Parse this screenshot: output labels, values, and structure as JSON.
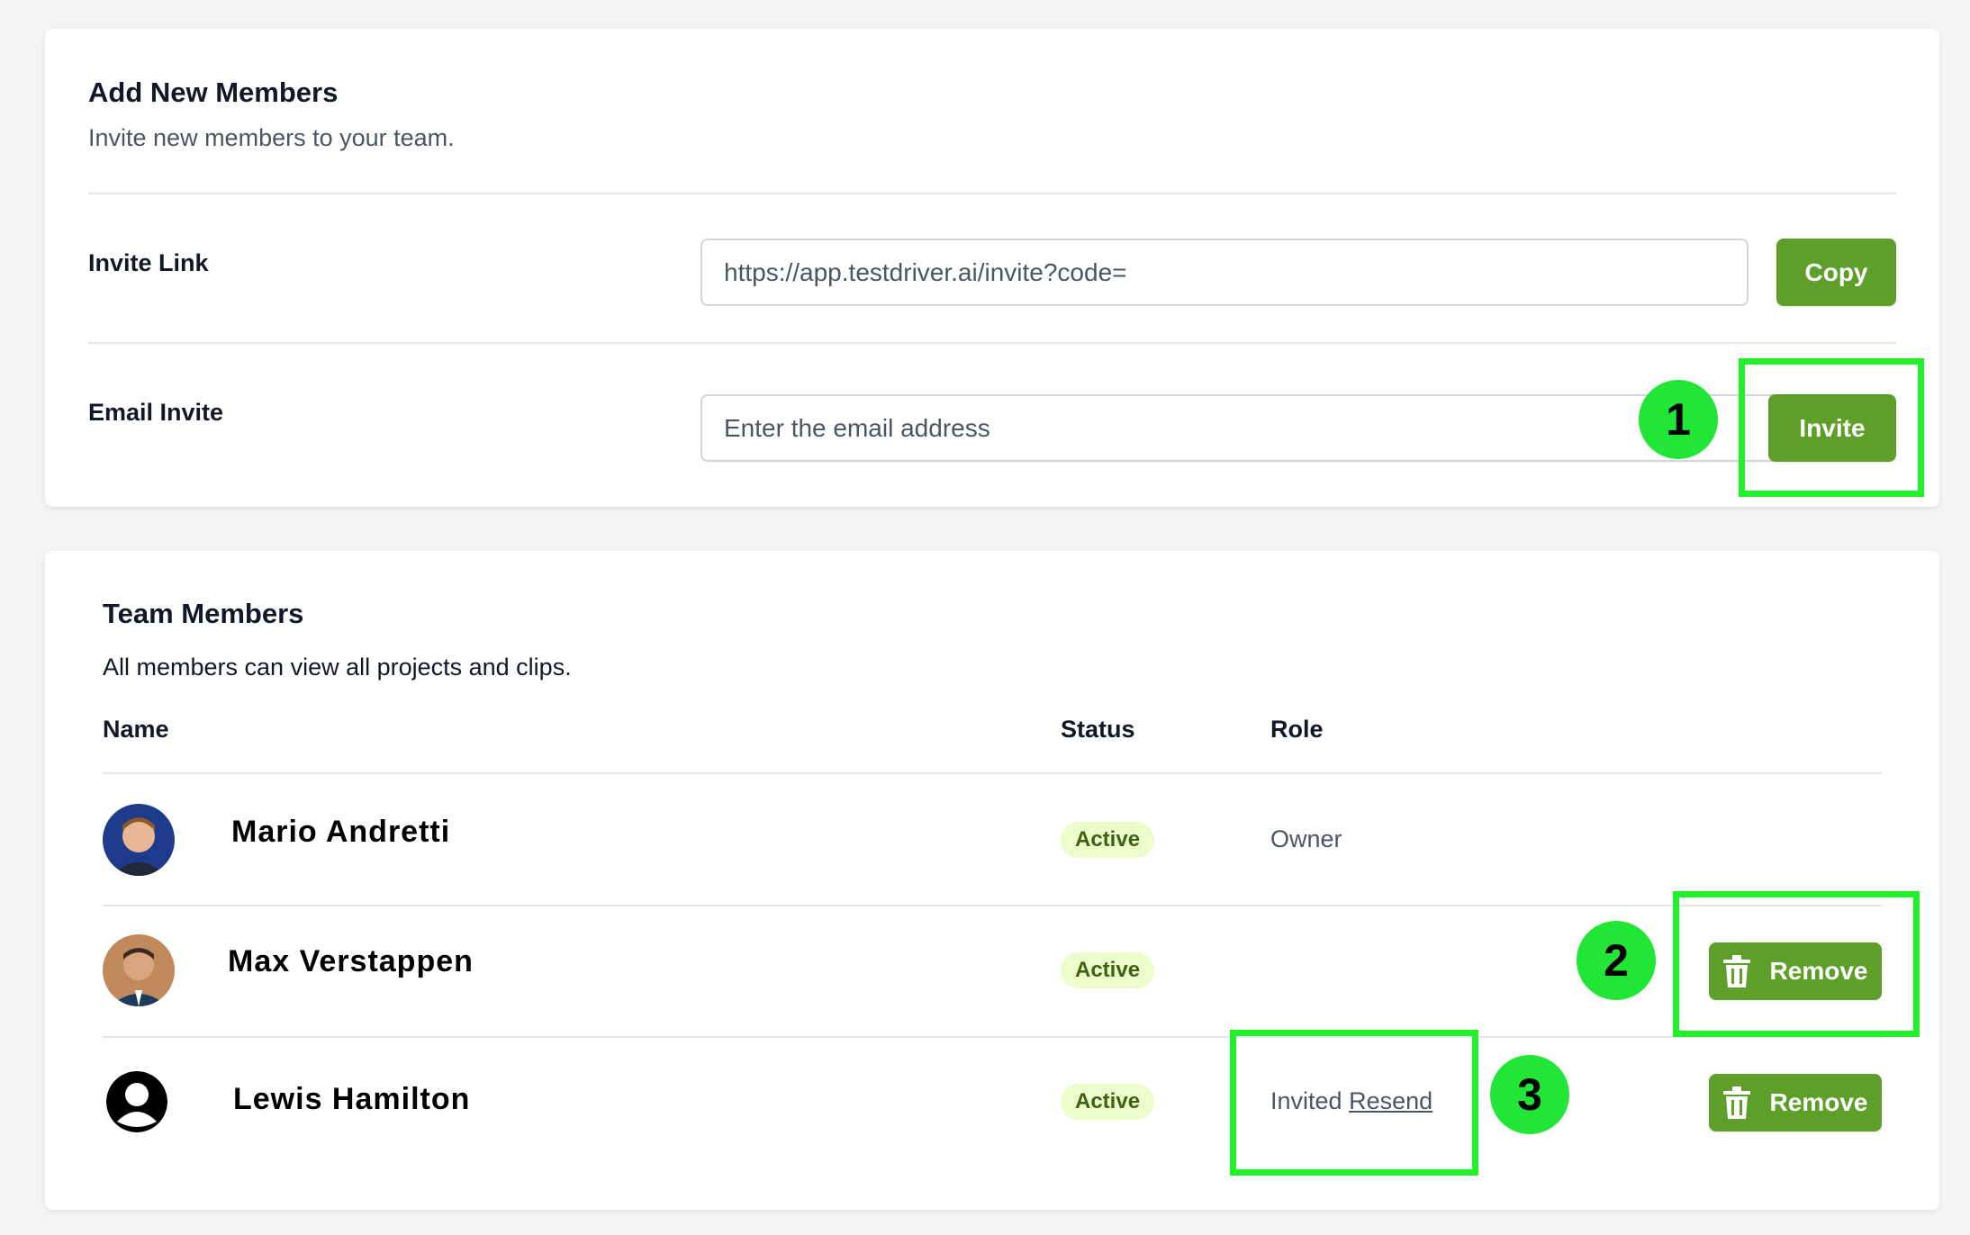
{
  "add_members": {
    "title": "Add New Members",
    "subtitle": "Invite new members to your team.",
    "invite_link": {
      "label": "Invite Link",
      "value": "https://app.testdriver.ai/invite?code=",
      "button": "Copy"
    },
    "email_invite": {
      "label": "Email Invite",
      "placeholder": "Enter the email address",
      "button": "Invite"
    }
  },
  "team": {
    "title": "Team Members",
    "subtitle": "All members can view all projects and clips.",
    "columns": {
      "name": "Name",
      "status": "Status",
      "role": "Role"
    },
    "members": [
      {
        "name": "Mario Andretti",
        "status": "Active",
        "role": "Owner"
      },
      {
        "name": "Max Verstappen",
        "status": "Active",
        "role": "",
        "action": "Remove"
      },
      {
        "name": "Lewis Hamilton",
        "status": "Active",
        "role": "Invited",
        "role_link": "Resend",
        "action": "Remove"
      }
    ]
  },
  "annotations": [
    "1",
    "2",
    "3"
  ],
  "colors": {
    "primary_button": "#5e9f2a",
    "badge_bg": "#ecfccb",
    "badge_text": "#3f6212",
    "annotation": "#22f02a"
  },
  "icons": [
    "trash-icon",
    "user-avatar-icon"
  ]
}
